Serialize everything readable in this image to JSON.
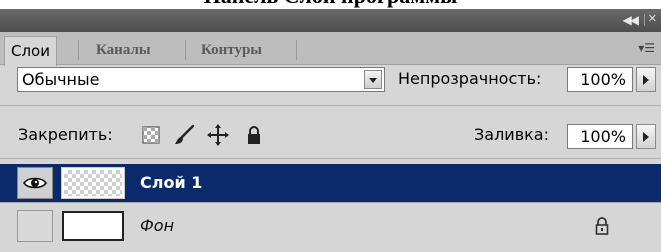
{
  "caption": "Панель Слои программы",
  "tabs": [
    {
      "label": "Слои",
      "active": true
    },
    {
      "label": "Каналы",
      "active": false
    },
    {
      "label": "Контуры",
      "active": false
    }
  ],
  "icons": {
    "collapse": "double-chevron-left-icon",
    "close": "close-icon",
    "menu": "panel-menu-icon"
  },
  "blend_mode": {
    "value": "Обычные"
  },
  "opacity": {
    "label": "Непрозрачность:",
    "value": "100%"
  },
  "lock": {
    "label": "Закрепить:",
    "icons": [
      "lock-transparent-pixels-icon",
      "lock-image-pixels-icon",
      "lock-position-icon",
      "lock-all-icon"
    ]
  },
  "fill": {
    "label": "Заливка:",
    "value": "100%"
  },
  "layers": [
    {
      "name": "Слой 1",
      "selected": true,
      "visible": true,
      "thumbnail": "transparent"
    },
    {
      "name": "Фон",
      "selected": false,
      "visible": false,
      "thumbnail": "white",
      "locked": true
    }
  ],
  "colors": {
    "selection": "#0b2a6b",
    "panel": "#d6d6d6",
    "titlebar": "#4d4d4d"
  }
}
